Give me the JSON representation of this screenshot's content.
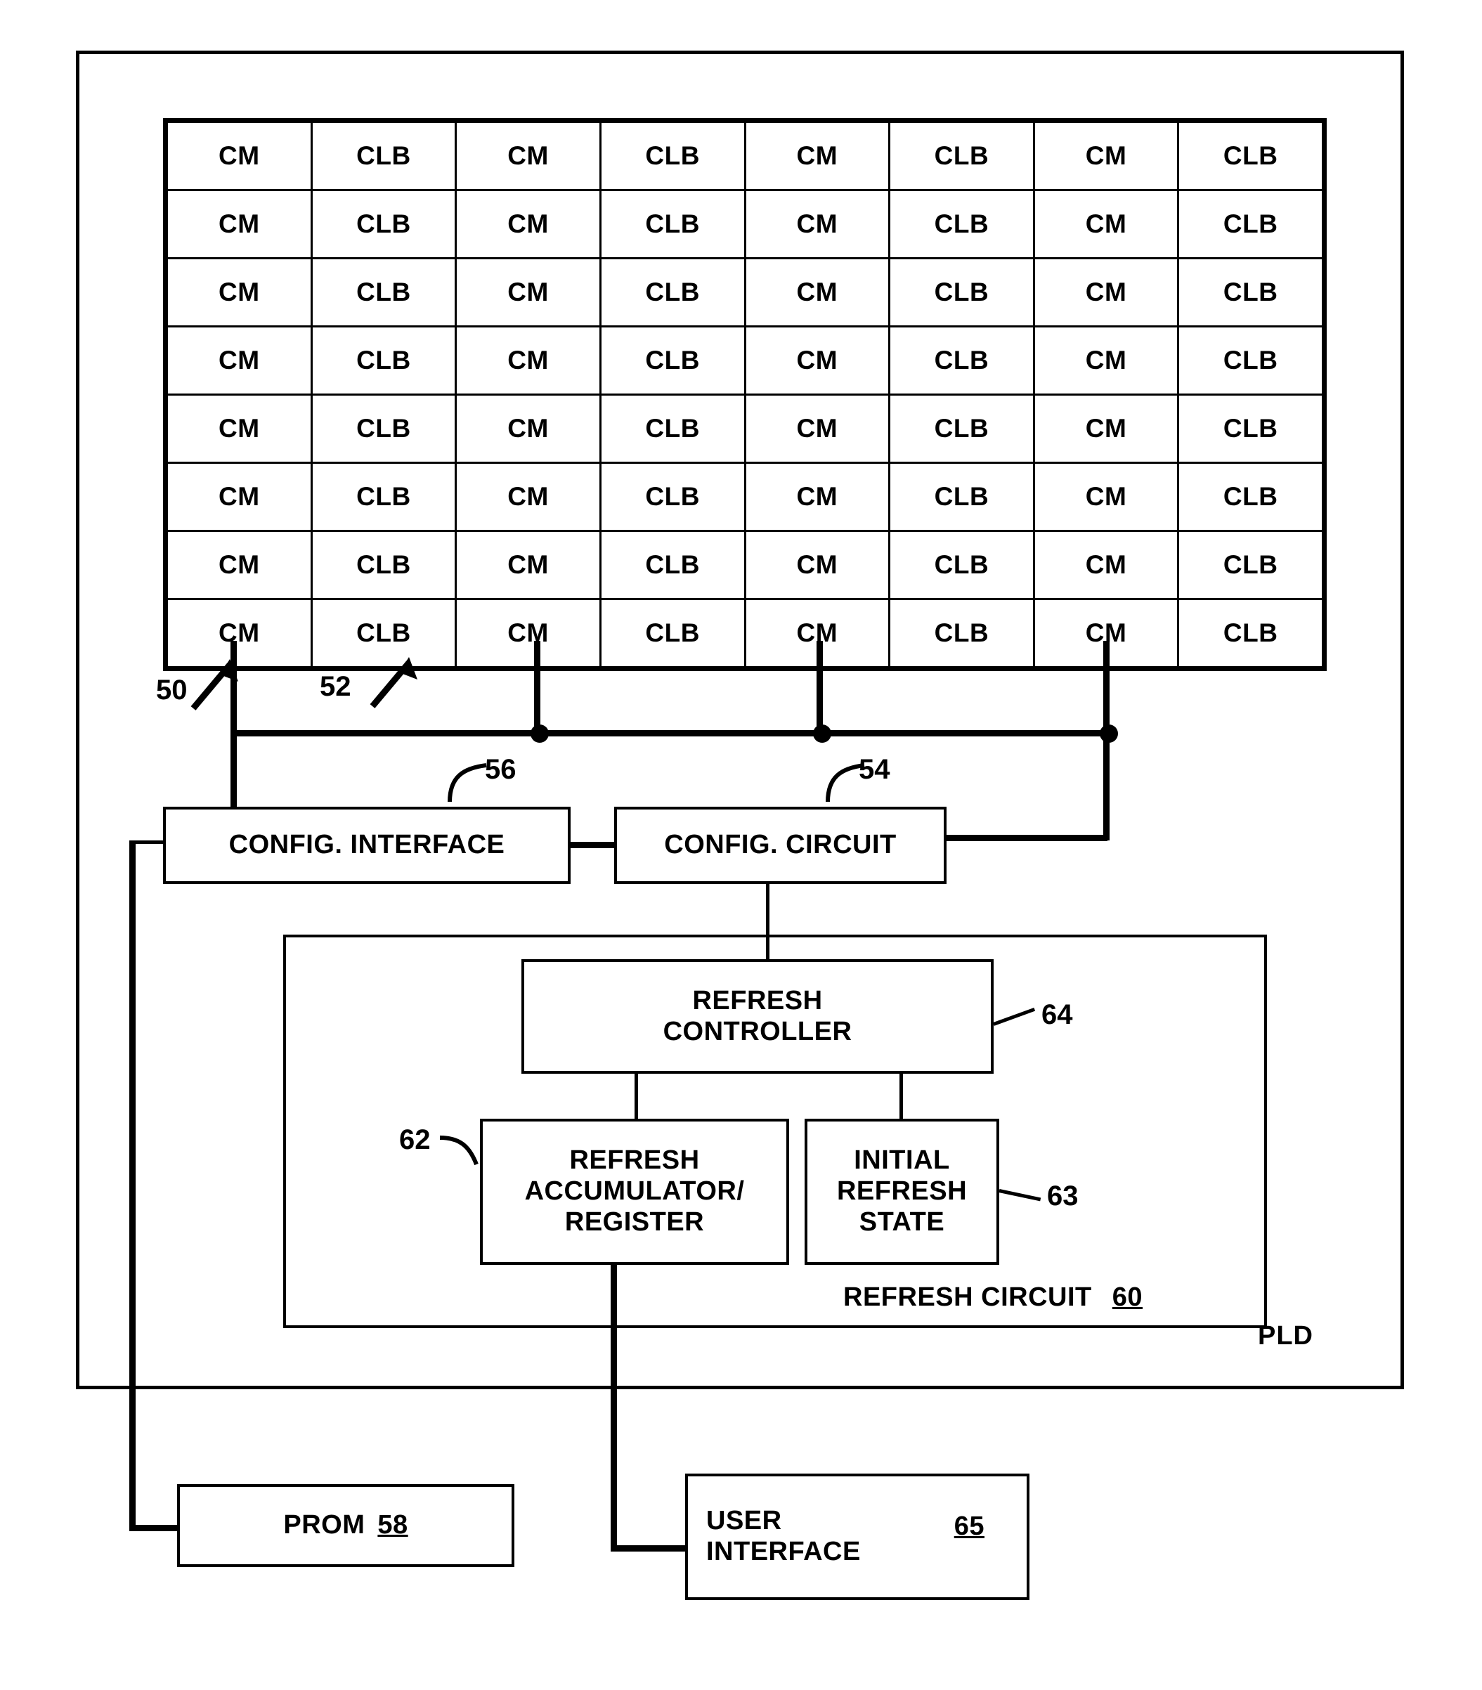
{
  "diagram": {
    "outer_label": "PLD",
    "grid": {
      "rows": 8,
      "columns": 8,
      "cells": [
        [
          "CM",
          "CLB",
          "CM",
          "CLB",
          "CM",
          "CLB",
          "CM",
          "CLB"
        ],
        [
          "CM",
          "CLB",
          "CM",
          "CLB",
          "CM",
          "CLB",
          "CM",
          "CLB"
        ],
        [
          "CM",
          "CLB",
          "CM",
          "CLB",
          "CM",
          "CLB",
          "CM",
          "CLB"
        ],
        [
          "CM",
          "CLB",
          "CM",
          "CLB",
          "CM",
          "CLB",
          "CM",
          "CLB"
        ],
        [
          "CM",
          "CLB",
          "CM",
          "CLB",
          "CM",
          "CLB",
          "CM",
          "CLB"
        ],
        [
          "CM",
          "CLB",
          "CM",
          "CLB",
          "CM",
          "CLB",
          "CM",
          "CLB"
        ],
        [
          "CM",
          "CLB",
          "CM",
          "CLB",
          "CM",
          "CLB",
          "CM",
          "CLB"
        ],
        [
          "CM",
          "CLB",
          "CM",
          "CLB",
          "CM",
          "CLB",
          "CM",
          "CLB"
        ]
      ]
    },
    "blocks": {
      "config_interface": "CONFIG. INTERFACE",
      "config_circuit": "CONFIG. CIRCUIT",
      "refresh_controller_line1": "REFRESH",
      "refresh_controller_line2": "CONTROLLER",
      "refresh_accumulator_line1": "REFRESH",
      "refresh_accumulator_line2": "ACCUMULATOR/",
      "refresh_accumulator_line3": "REGISTER",
      "initial_refresh_state_line1": "INITIAL",
      "initial_refresh_state_line2": "REFRESH",
      "initial_refresh_state_line3": "STATE",
      "refresh_circuit_label": "REFRESH CIRCUIT",
      "refresh_circuit_number": "60",
      "prom_label": "PROM",
      "prom_number": "58",
      "user_interface_line1": "USER",
      "user_interface_line2": "INTERFACE",
      "user_interface_number": "65"
    },
    "reference_numerals": {
      "cm_column": "50",
      "clb_column": "52",
      "config_interface": "56",
      "config_circuit": "54",
      "refresh_controller": "64",
      "refresh_accumulator": "62",
      "initial_refresh_state": "63"
    }
  }
}
